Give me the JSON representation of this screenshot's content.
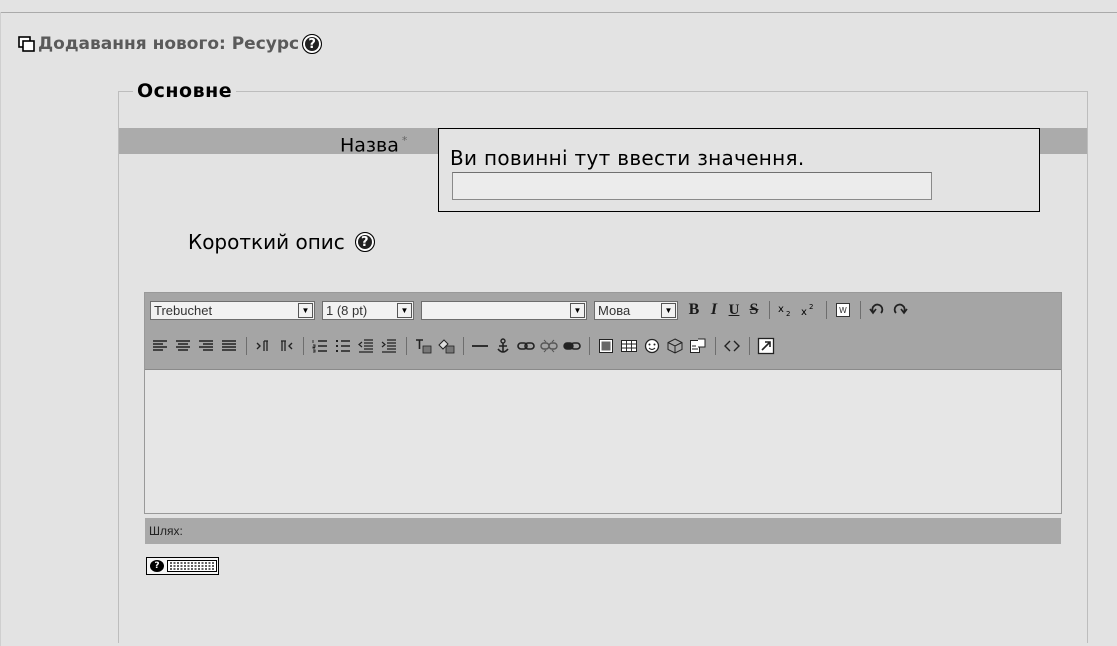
{
  "page": {
    "heading": "Додавання нового: Ресурс"
  },
  "section": {
    "legend": "Основне"
  },
  "name_field": {
    "label": "Назва",
    "required_mark": "*",
    "error": "Ви повинні тут ввести значення.",
    "value": ""
  },
  "description": {
    "label": "Короткий опис"
  },
  "editor": {
    "font_family": "Trebuchet",
    "font_size": "1 (8 pt)",
    "style": "",
    "language": "Мова",
    "path_label": "Шлях:",
    "content": ""
  },
  "icons": {
    "help": "?",
    "bold": "B",
    "italic": "I",
    "underline": "U",
    "strikethrough": "S"
  }
}
